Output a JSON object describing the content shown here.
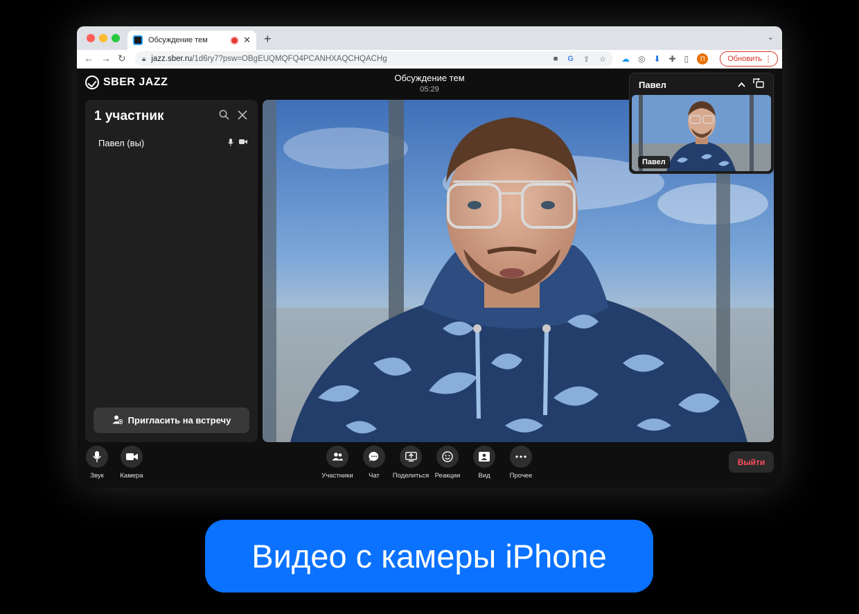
{
  "browser": {
    "tab_title": "Обсуждение тем",
    "tab_close": "✕",
    "new_tab": "+",
    "tabs_menu": "⌄",
    "url_host": "jazz.sber.ru",
    "url_path": "/1d6ry7?psw=OBgEUQMQFQ4PCANHXAQCHQACHg",
    "update_label": "Обновить",
    "profile_initial": "П"
  },
  "app": {
    "logo_text": "SBER JAZZ",
    "meeting_title": "Обсуждение тем",
    "timer": "05:29"
  },
  "sidebar": {
    "title": "1 участник",
    "participant_name": "Павел (вы)",
    "invite_label": "Пригласить на встречу"
  },
  "pip": {
    "name": "Павел",
    "label": "Павел"
  },
  "controls": {
    "sound": "Звук",
    "camera": "Камера",
    "participants": "Участники",
    "chat": "Чат",
    "share": "Поделиться",
    "reactions": "Реакции",
    "view": "Вид",
    "more": "Прочее",
    "exit": "Выйти"
  },
  "caption": {
    "text": "Видео с камеры iPhone"
  },
  "colors": {
    "accent_blue": "#0a72ff",
    "exit_red": "#ff4f5e",
    "update_red": "#d93025"
  },
  "icons": {
    "search": "search-icon",
    "close": "close-icon",
    "mic": "microphone-icon",
    "camera": "camera-icon",
    "participants": "people-icon",
    "chat": "chat-bubble-icon",
    "share": "screen-share-icon",
    "reactions": "smiley-icon",
    "view": "view-layout-icon",
    "more": "more-dots-icon"
  }
}
